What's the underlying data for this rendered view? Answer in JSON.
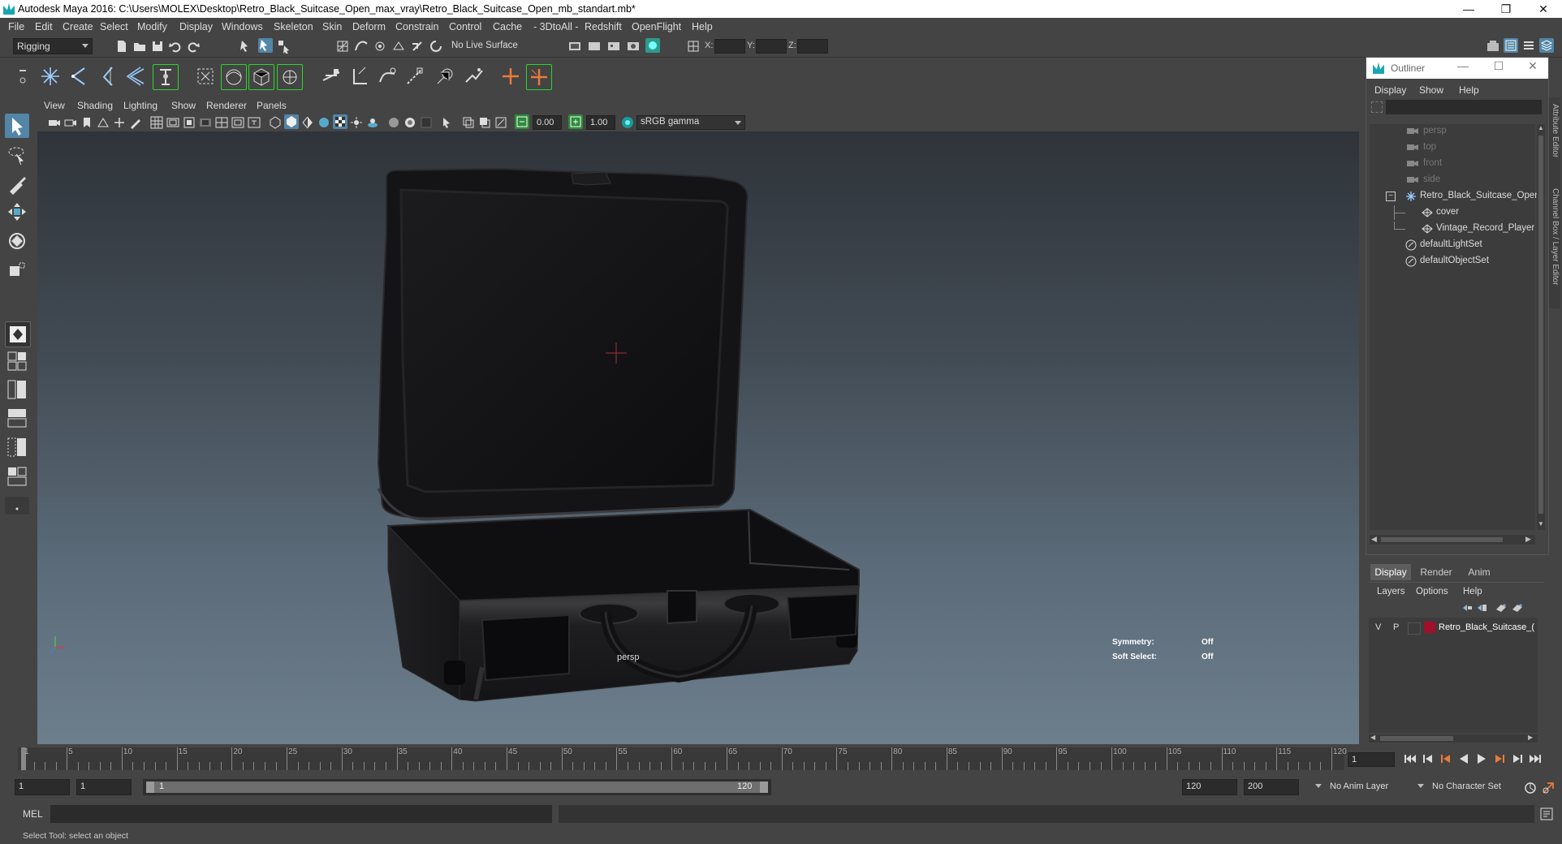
{
  "window": {
    "title": "Autodesk Maya 2016: C:\\Users\\MOLEX\\Desktop\\Retro_Black_Suitcase_Open_max_vray\\Retro_Black_Suitcase_Open_mb_standart.mb*",
    "minimize": "—",
    "restore": "❐",
    "close": "✕"
  },
  "menubar": [
    "File",
    "Edit",
    "Create",
    "Select",
    "Modify",
    "Display",
    "Windows",
    "Skeleton",
    "Skin",
    "Deform",
    "Constrain",
    "Control",
    "Cache",
    "- 3DtoAll -",
    "Redshift",
    "OpenFlight",
    "Help"
  ],
  "statusline": {
    "menuset": "Rigging",
    "live_surface": "No Live Surface",
    "x_label": "X:",
    "y_label": "Y:",
    "z_label": "Z:"
  },
  "viewport": {
    "menu": [
      "View",
      "Shading",
      "Lighting",
      "Show",
      "Renderer",
      "Panels"
    ],
    "exposure": "0.00",
    "gamma": "1.00",
    "color_space": "sRGB gamma",
    "camera_label": "persp",
    "symmetry_label": "Symmetry:",
    "symmetry_value": "Off",
    "soft_select_label": "Soft Select:",
    "soft_select_value": "Off"
  },
  "outliner": {
    "title": "Outliner",
    "menu": [
      "Display",
      "Show",
      "Help"
    ],
    "items": [
      {
        "label": "persp",
        "type": "camera",
        "dim": true
      },
      {
        "label": "top",
        "type": "camera",
        "dim": true
      },
      {
        "label": "front",
        "type": "camera",
        "dim": true
      },
      {
        "label": "side",
        "type": "camera",
        "dim": true
      },
      {
        "label": "Retro_Black_Suitcase_Open_",
        "type": "group",
        "dim": false
      },
      {
        "label": "cover",
        "type": "mesh",
        "dim": false
      },
      {
        "label": "Vintage_Record_Player",
        "type": "mesh",
        "dim": false
      },
      {
        "label": "defaultLightSet",
        "type": "set",
        "dim": false
      },
      {
        "label": "defaultObjectSet",
        "type": "set",
        "dim": false
      }
    ],
    "side_labels": [
      "Attribute Editor",
      "Channel Box / Layer Editor"
    ]
  },
  "layer_editor": {
    "tabs": [
      "Display",
      "Render",
      "Anim"
    ],
    "menu": [
      "Layers",
      "Options",
      "Help"
    ],
    "layer": {
      "v": "V",
      "p": "P",
      "name": "Retro_Black_Suitcase_(",
      "color": "#a0102a"
    }
  },
  "timeline": {
    "ticks": [
      "1",
      "5",
      "10",
      "15",
      "20",
      "25",
      "30",
      "35",
      "40",
      "45",
      "50",
      "55",
      "60",
      "65",
      "70",
      "75",
      "80",
      "85",
      "90",
      "95",
      "100",
      "105",
      "110",
      "115",
      "120"
    ],
    "current_frame": "1"
  },
  "range": {
    "start": "1",
    "inner_start": "1",
    "slider_start": "1",
    "slider_end": "120",
    "end": "120",
    "max_end": "200",
    "anim_layer": "No Anim Layer",
    "character_set": "No Character Set"
  },
  "cmdline": {
    "label": "MEL"
  },
  "helpline": {
    "text": "Select Tool: select an object"
  }
}
